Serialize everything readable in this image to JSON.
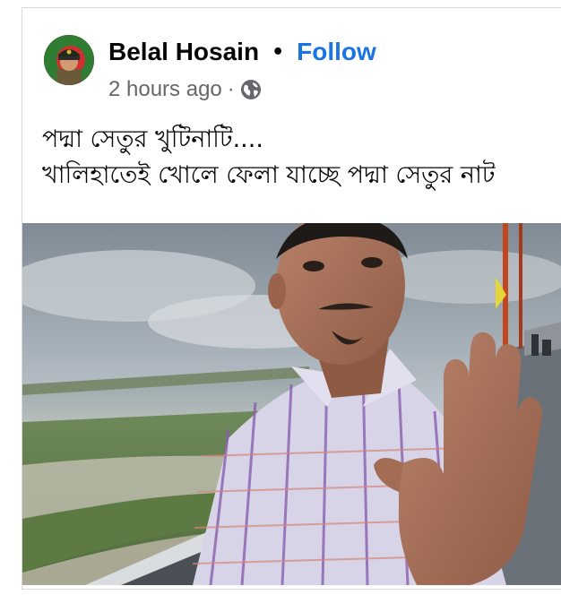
{
  "post": {
    "author": {
      "name": "Belal Hosain",
      "separator": "•",
      "follow_label": "Follow"
    },
    "meta": {
      "time": "2 hours ago",
      "separator": "·",
      "audience_icon": "globe-icon"
    },
    "text_lines": [
      "পদ্মা সেতুর খুটিনাটি....",
      "খালিহাতেই খোলে ফেলা যাচ্ছে পদ্মা সেতুর নাট"
    ],
    "media": {
      "type": "photo",
      "subject": "man waving hand on bridge beside river"
    }
  },
  "colors": {
    "follow": "#1b74e4",
    "meta_text": "#65676b",
    "text": "#050505"
  }
}
